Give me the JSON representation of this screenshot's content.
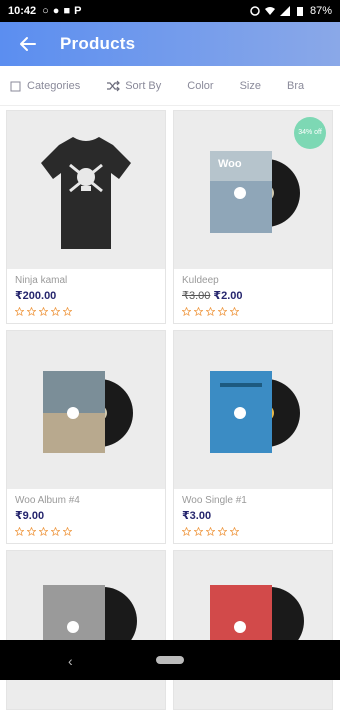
{
  "status": {
    "time": "10:42",
    "battery": "87%",
    "left_glyphs": [
      "○",
      "●",
      "■",
      "P"
    ]
  },
  "appbar": {
    "title": "Products"
  },
  "filters": [
    {
      "label": "Categories",
      "icon": "checkbox-icon"
    },
    {
      "label": "Sort By",
      "icon": "shuffle-icon"
    },
    {
      "label": "Color",
      "icon": ""
    },
    {
      "label": "Size",
      "icon": ""
    },
    {
      "label": "Bra",
      "icon": ""
    }
  ],
  "products": [
    {
      "name": "Ninja kamal",
      "price": "₹200.00",
      "old_price": "",
      "rating": 0,
      "badge": "",
      "art": "tshirt",
      "color": "#2a2a2a"
    },
    {
      "name": "Kuldeep",
      "price": "₹2.00",
      "old_price": "₹3.00",
      "rating": 0,
      "badge": "34% off",
      "art": "vinyl",
      "color": "#8fa6b8"
    },
    {
      "name": "Woo Album #4",
      "price": "₹9.00",
      "old_price": "",
      "rating": 0,
      "badge": "",
      "art": "vinyl",
      "color": "#b8a98e"
    },
    {
      "name": "Woo Single #1",
      "price": "₹3.00",
      "old_price": "",
      "rating": 0,
      "badge": "",
      "art": "vinyl",
      "color": "#3b8cc4"
    },
    {
      "name": "",
      "price": "",
      "old_price": "",
      "rating": 0,
      "badge": "",
      "art": "vinyl",
      "color": "#9a9a9a"
    },
    {
      "name": "",
      "price": "",
      "old_price": "",
      "rating": 0,
      "badge": "",
      "art": "vinyl",
      "color": "#d24a4a"
    }
  ],
  "colors": {
    "appbar_start": "#5b8ef0",
    "appbar_end": "#8aa8e8",
    "price": "#26266e",
    "star": "#f0a050",
    "badge": "#7dd8b4"
  }
}
